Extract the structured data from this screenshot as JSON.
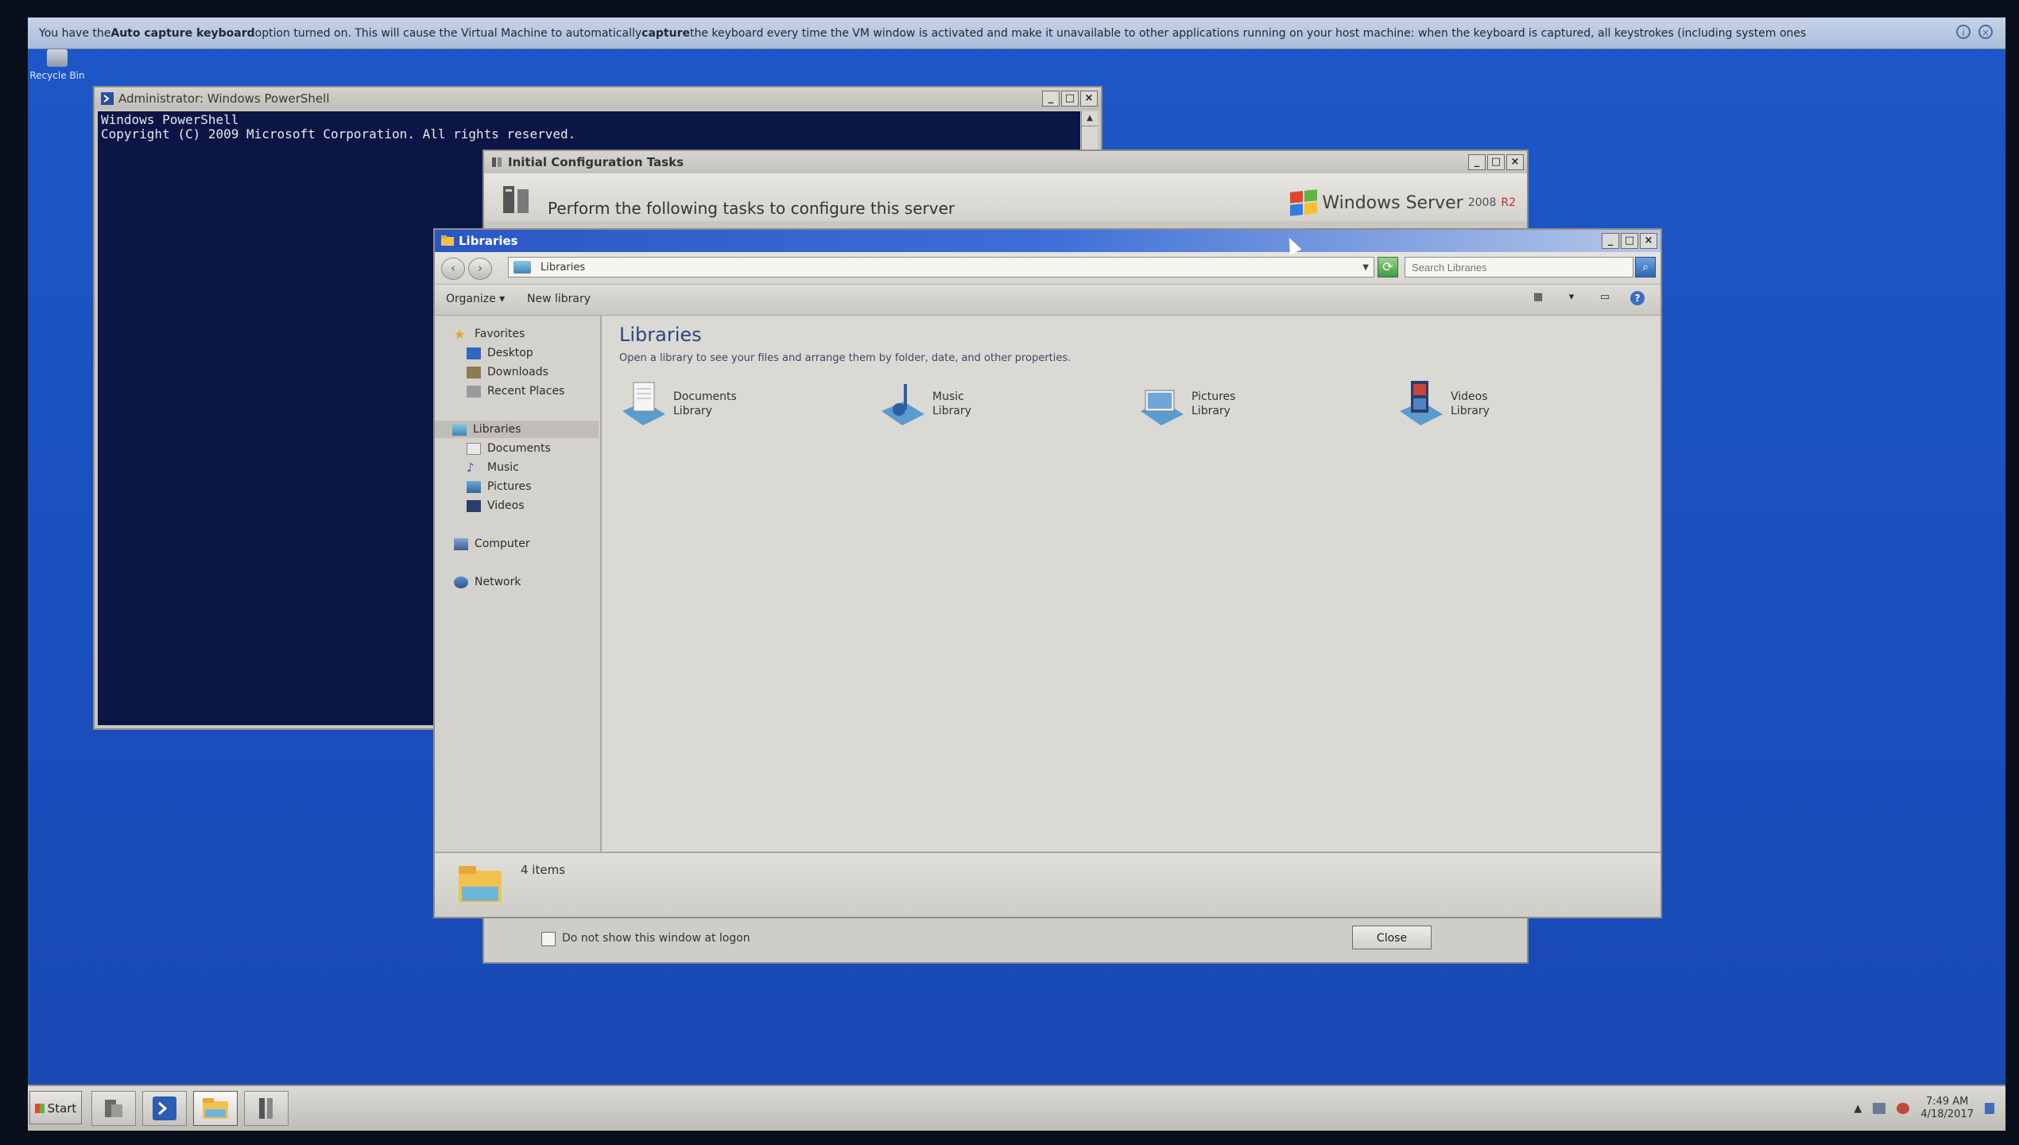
{
  "vm_notice": {
    "part1": "You have the ",
    "bold1": "Auto capture keyboard",
    "part2": " option turned on. This will cause the Virtual Machine to automatically ",
    "bold2": "capture",
    "part3": " the keyboard every time the VM window is activated and make it unavailable to other applications running on your host machine: when the keyboard is captured, all keystrokes (including system ones"
  },
  "desktop": {
    "recycle_bin_label": "Recycle Bin"
  },
  "powershell": {
    "title": "Administrator: Windows PowerShell",
    "lines": [
      "Windows PowerShell",
      "Copyright (C) 2009 Microsoft Corporation. All rights reserved."
    ]
  },
  "initial_config": {
    "title": "Initial Configuration Tasks",
    "perform_text": "Perform the following tasks to configure this server",
    "logo_text": "Windows Server",
    "logo_version": "2008",
    "logo_r2": "R2",
    "checkbox_label": "Do not show this window at logon",
    "close_label": "Close"
  },
  "libraries": {
    "title": "Libraries",
    "address": "Libraries",
    "search_placeholder": "Search Libraries",
    "toolbar": {
      "organize": "Organize",
      "new_library": "New library"
    },
    "nav": {
      "favorites": "Favorites",
      "desktop": "Desktop",
      "downloads": "Downloads",
      "recent_places": "Recent Places",
      "libraries": "Libraries",
      "documents": "Documents",
      "music": "Music",
      "pictures": "Pictures",
      "videos": "Videos",
      "computer": "Computer",
      "network": "Network"
    },
    "heading": "Libraries",
    "subheading": "Open a library to see your files and arrange them by folder, date, and other properties.",
    "items": [
      {
        "name": "Documents",
        "type": "Library"
      },
      {
        "name": "Music",
        "type": "Library"
      },
      {
        "name": "Pictures",
        "type": "Library"
      },
      {
        "name": "Videos",
        "type": "Library"
      }
    ],
    "status_count": "4 items"
  },
  "taskbar": {
    "start_label": "Start",
    "time": "7:49 AM",
    "date": "4/18/2017"
  },
  "colors": {
    "desktop_blue": "#1a4fbf",
    "console_bg": "#0b1647",
    "active_title": "#2a57c4"
  }
}
